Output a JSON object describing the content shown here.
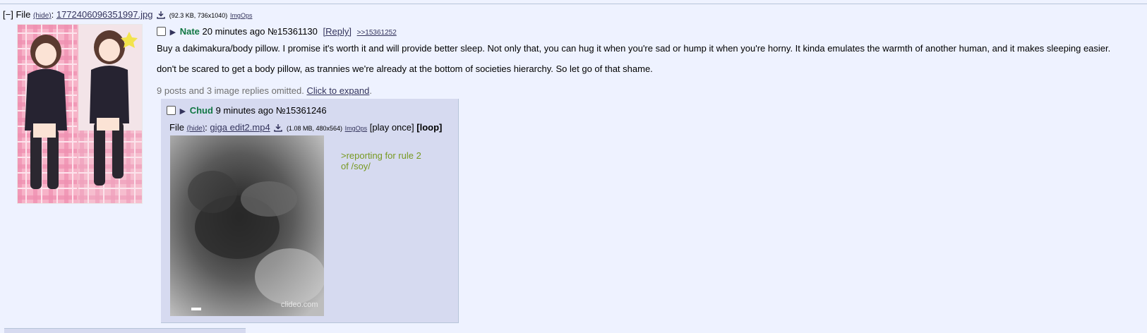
{
  "op": {
    "file": {
      "prefix": "[−]",
      "file_label": "File",
      "hide_label": "(hide)",
      "colon": ":",
      "filename": "1772406096351997.jpg",
      "meta": "(92.3 KB, 736x1040)",
      "imgops": "ImgOps"
    },
    "name": "Nate",
    "time": "20 minutes ago",
    "post_no": "№15361130",
    "reply_link": "[Reply]",
    "backlink": ">>15361252",
    "message": [
      "Buy a dakimakura/body pillow. I promise it's worth it and will provide better sleep. Not only that, you can hug it when you're sad or hump it when you're horny. It kinda emulates the warmth of another human, and it makes sleeping easier.",
      "don't be scared to get a body pillow, as trannies we're already at the bottom of societies hierarchy. So let go of that shame."
    ],
    "omitted_text": "9 posts and 3 image replies omitted.",
    "expand_link": "Click to expand",
    "expand_period": "."
  },
  "reply": {
    "name": "Chud",
    "time": "9 minutes ago",
    "post_no": "№15361246",
    "file": {
      "file_label": "File",
      "hide_label": "(hide)",
      "colon": ":",
      "filename": "giga edit2.mp4",
      "meta": "(1.08 MB, 480x564)",
      "imgops": "ImgOps",
      "play_once": "[play once]",
      "loop": "[loop]"
    },
    "watermark": "clideo.com",
    "greentext": ">reporting for rule 2\nof /soy/"
  },
  "icons": {
    "checkbox": "checkbox-icon",
    "arrow": "triangle-right-icon",
    "download": "download-icon"
  },
  "colors": {
    "background": "#eef2ff",
    "reply_background": "#d6daf0",
    "name": "#117743",
    "link": "#34345c",
    "greentext": "#789922"
  }
}
